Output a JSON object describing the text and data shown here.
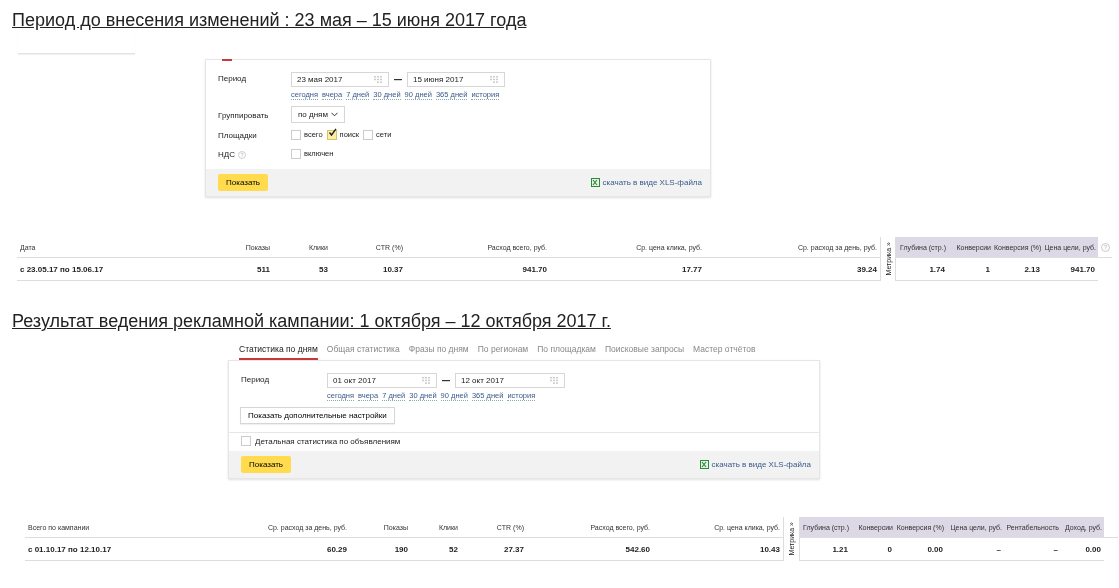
{
  "sections": [
    {
      "heading": "Период до внесения изменений : 23 мая – 15 июня 2017 года",
      "panel": {
        "tab_stub": true,
        "rows": [
          {
            "kind": "period",
            "label": "Период",
            "from": "23 мая 2017",
            "to": "15 июня 2017",
            "links": [
              "сегодня",
              "вчера",
              "7 дней",
              "30 дней",
              "90 дней",
              "365 дней",
              "история"
            ]
          },
          {
            "kind": "select",
            "label": "Группировать",
            "value": "по дням"
          },
          {
            "kind": "checks",
            "label": "Площадки",
            "options": [
              {
                "label": "всего",
                "checked": false
              },
              {
                "label": "поиск",
                "checked": true
              },
              {
                "label": "сети",
                "checked": false
              }
            ]
          },
          {
            "kind": "checks",
            "label": "НДС",
            "help": true,
            "options": [
              {
                "label": "включен",
                "checked": false
              }
            ]
          }
        ],
        "submit": "Показать",
        "download": "скачать в виде XLS-файла"
      },
      "table": {
        "help": true,
        "columns": [
          {
            "label": "Дата",
            "kind": "text"
          },
          {
            "label": "Показы",
            "kind": "num"
          },
          {
            "label": "Клики",
            "kind": "num"
          },
          {
            "label": "CTR (%)",
            "kind": "num"
          },
          {
            "label": "Расход всего, руб.",
            "kind": "num"
          },
          {
            "label": "Ср. цена клика, руб.",
            "kind": "num"
          },
          {
            "label": "Ср. расход за день, руб.",
            "kind": "num"
          },
          {
            "label": "Метрика »",
            "kind": "toggle"
          },
          {
            "label": "Глубина (стр.)",
            "kind": "metric"
          },
          {
            "label": "Конверсии",
            "kind": "metric"
          },
          {
            "label": "Конверсия (%)",
            "kind": "metric"
          },
          {
            "label": "Цена цели, руб.",
            "kind": "metric"
          }
        ],
        "row": [
          "с 23.05.17 по 15.06.17",
          "511",
          "53",
          "10.37",
          "941.70",
          "17.77",
          "39.24",
          "1.74",
          "1",
          "2.13",
          "941.70"
        ]
      }
    },
    {
      "heading": "Результат ведения рекламной кампании: 1 октября – 12 октября 2017 г.",
      "panel": {
        "tab_stub": false,
        "tabs": [
          {
            "label": "Статистика по дням",
            "selected": true
          },
          {
            "label": "Общая статистика",
            "selected": false
          },
          {
            "label": "Фразы по дням",
            "selected": false
          },
          {
            "label": "По регионам",
            "selected": false
          },
          {
            "label": "По площадкам",
            "selected": false
          },
          {
            "label": "Поисковые запросы",
            "selected": false
          },
          {
            "label": "Мастер отчётов",
            "selected": false
          }
        ],
        "rows": [
          {
            "kind": "period",
            "label": "Период",
            "from": "01 окт 2017",
            "to": "12 окт 2017",
            "links": [
              "сегодня",
              "вчера",
              "7 дней",
              "30 дней",
              "90 дней",
              "365 дней",
              "история"
            ]
          },
          {
            "kind": "button",
            "label": "Показать дополнительные настройки"
          },
          {
            "kind": "detail",
            "label": "Детальная статистика по объявлениям",
            "checked": false
          }
        ],
        "submit": "Показать",
        "download": "скачать в виде XLS-файла"
      },
      "table": {
        "columns": [
          {
            "label": "Всего по кампании",
            "kind": "text"
          },
          {
            "label": "Ср. расход за день, руб.",
            "kind": "num"
          },
          {
            "label": "Показы",
            "kind": "num"
          },
          {
            "label": "Клики",
            "kind": "num"
          },
          {
            "label": "CTR (%)",
            "kind": "num"
          },
          {
            "label": "Расход всего, руб.",
            "kind": "num"
          },
          {
            "label": "Ср. цена клика, руб.",
            "kind": "num"
          },
          {
            "label": "Метрика »",
            "kind": "toggle"
          },
          {
            "label": "Глубина (стр.)",
            "kind": "metric"
          },
          {
            "label": "Конверсии",
            "kind": "metric"
          },
          {
            "label": "Конверсия (%)",
            "kind": "metric"
          },
          {
            "label": "Цена цели, руб.",
            "kind": "metric"
          },
          {
            "label": "Рентабельность",
            "kind": "metric"
          },
          {
            "label": "Доход, руб.",
            "kind": "metric"
          }
        ],
        "row": [
          "с 01.10.17 по 12.10.17",
          "60.29",
          "190",
          "52",
          "27.37",
          "542.60",
          "10.43",
          "1.21",
          "0",
          "0.00",
          "–",
          "–",
          "0.00"
        ]
      }
    }
  ]
}
